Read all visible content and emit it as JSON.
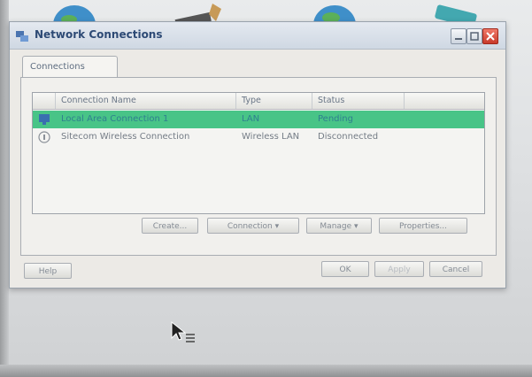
{
  "window": {
    "title": "Network Connections"
  },
  "tabs": [
    {
      "label": "Connections"
    }
  ],
  "list": {
    "columns": [
      "Connection Name",
      "Type",
      "Status"
    ],
    "rows": [
      {
        "name": "Local Area Connection 1",
        "type": "LAN",
        "status": "Pending",
        "icon": "wired-network-icon",
        "selected": true
      },
      {
        "name": "Sitecom Wireless Connection",
        "type": "Wireless LAN",
        "status": "Disconnected",
        "icon": "wireless-network-icon",
        "selected": false
      }
    ]
  },
  "panel_buttons": {
    "create": "Create...",
    "connection": "Connection",
    "manage": "Manage",
    "properties": "Properties..."
  },
  "footer_buttons": {
    "help": "Help",
    "ok": "OK",
    "apply": "Apply",
    "cancel": "Cancel"
  },
  "colors": {
    "selection": "#48c487",
    "title_text": "#2d4a75"
  }
}
